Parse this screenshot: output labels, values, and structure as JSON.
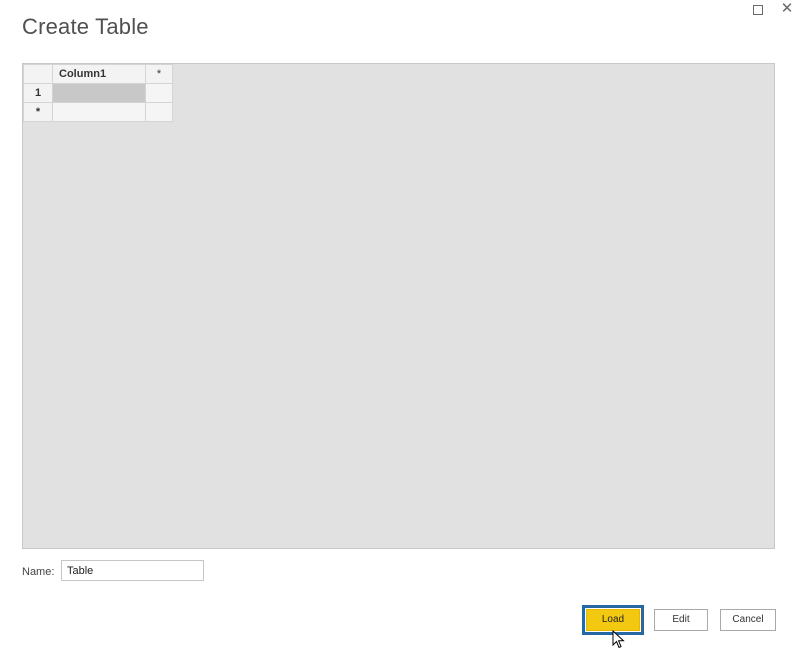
{
  "dialog": {
    "title": "Create Table"
  },
  "window_controls": {
    "maximize_icon": "maximize-icon",
    "close_icon": "close-icon",
    "close_glyph": "✕"
  },
  "table": {
    "corner": "",
    "columns": [
      "Column1"
    ],
    "add_column_marker": "*",
    "rows": [
      {
        "header": "1",
        "cells": [
          ""
        ]
      }
    ],
    "new_row_marker": "*"
  },
  "name_field": {
    "label": "Name:",
    "value": "Table"
  },
  "buttons": {
    "load": "Load",
    "edit": "Edit",
    "cancel": "Cancel"
  },
  "colors": {
    "load_button": "#f2c811",
    "focus_border": "#2568a3",
    "grid_background": "#e1e1e1"
  }
}
